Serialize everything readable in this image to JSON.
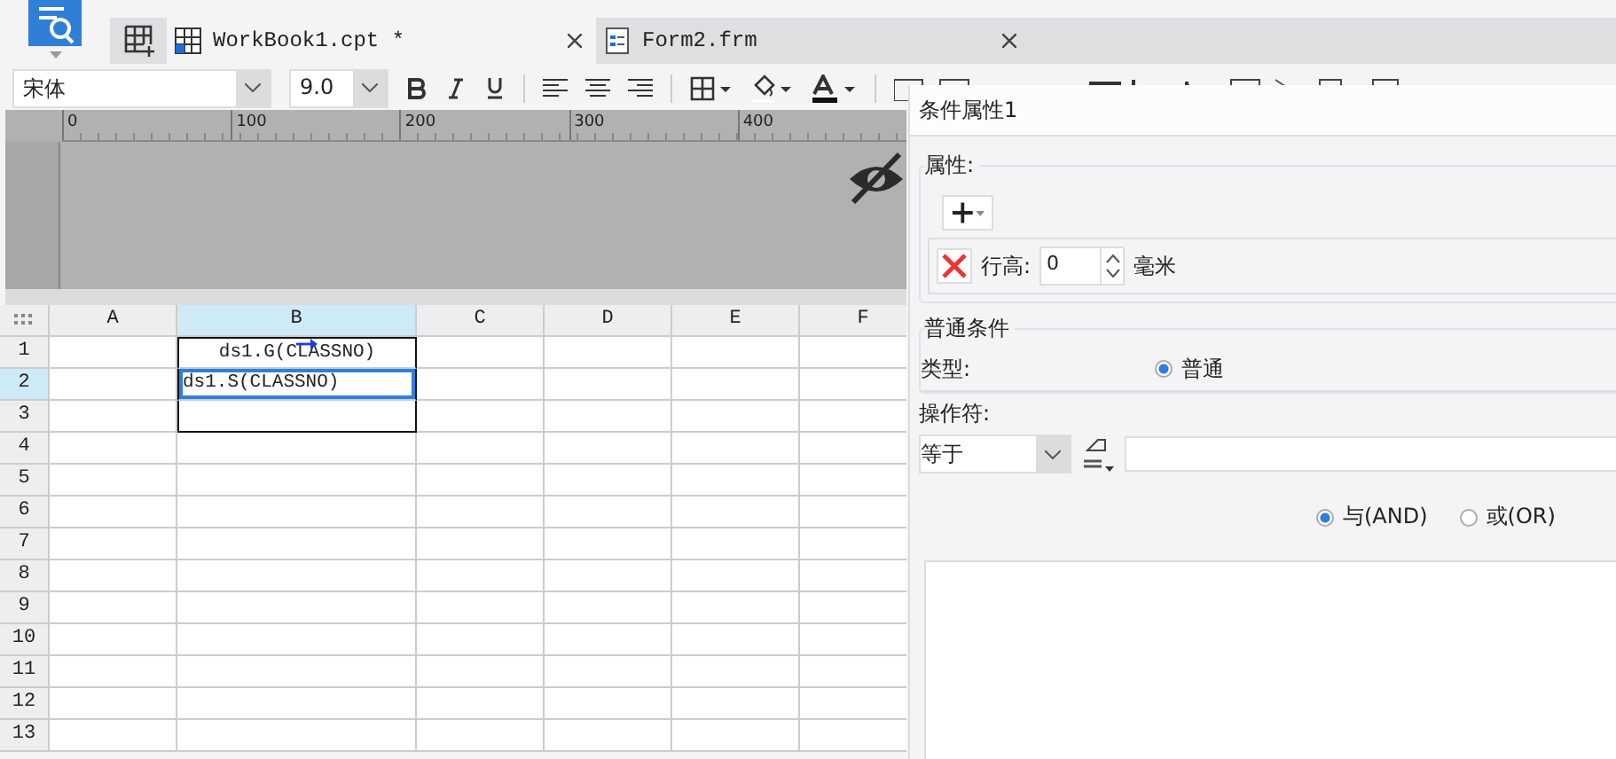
{
  "tabs": [
    {
      "label": "WorkBook1.cpt *",
      "kind": "grid",
      "selected": true
    },
    {
      "label": "Form2.frm",
      "kind": "form",
      "selected": false
    }
  ],
  "format_toolbar": {
    "font": "宋体",
    "size": "9.0"
  },
  "ruler": {
    "ticks": [
      "0",
      "100",
      "200",
      "300",
      "400"
    ]
  },
  "sheet": {
    "columns": [
      {
        "label": "A",
        "selected": false
      },
      {
        "label": "B",
        "selected": true
      },
      {
        "label": "C",
        "selected": false
      },
      {
        "label": "D",
        "selected": false
      },
      {
        "label": "E",
        "selected": false
      },
      {
        "label": "F",
        "selected": false
      }
    ],
    "rows": [
      {
        "label": "1",
        "selected": false,
        "cells": {
          "B": {
            "text": "ds1.G(CLASSNO)",
            "centered": true,
            "selected": false,
            "expand_arrow": true
          }
        }
      },
      {
        "label": "2",
        "selected": true,
        "cells": {
          "B": {
            "text": "ds1.S(CLASSNO)",
            "centered": false,
            "selected": true,
            "expand_arrow": false
          }
        }
      },
      {
        "label": "3",
        "selected": false
      },
      {
        "label": "4",
        "selected": false
      },
      {
        "label": "5",
        "selected": false
      },
      {
        "label": "6",
        "selected": false
      },
      {
        "label": "7",
        "selected": false
      },
      {
        "label": "8",
        "selected": false
      },
      {
        "label": "9",
        "selected": false
      },
      {
        "label": "10",
        "selected": false
      },
      {
        "label": "11",
        "selected": false
      },
      {
        "label": "12",
        "selected": false
      },
      {
        "label": "13",
        "selected": false
      }
    ]
  },
  "panel": {
    "title": "条件属性1",
    "properties": {
      "legend": "属性:",
      "row_height_label": "行高:",
      "row_height_value": "0",
      "unit": "毫米"
    },
    "normal_condition": {
      "legend": "普通条件",
      "type_label": "类型:",
      "type_options": [
        {
          "label": "普通",
          "selected": true
        }
      ],
      "operator_label": "操作符:",
      "operator": "等于",
      "logic": [
        {
          "label": "与(AND)",
          "selected": true
        },
        {
          "label": "或(OR)",
          "selected": false
        }
      ]
    }
  }
}
